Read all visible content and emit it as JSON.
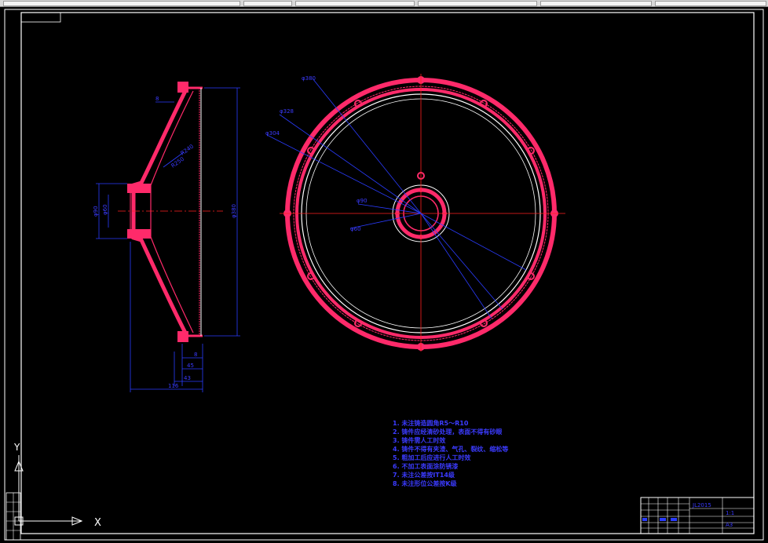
{
  "window": {
    "toolbar_segments": 6
  },
  "colors": {
    "background": "#000000",
    "frame": "#ffffff",
    "part": "#ff2a6a",
    "centerline": "#ff2020",
    "dimension": "#2a3cff",
    "titleblock": "#ffffff"
  },
  "side_view": {
    "dims": {
      "overall_height": "φ380",
      "hub_outer": "φ90",
      "hub_inner": "φ60",
      "inner_radius_1": "R240",
      "inner_radius_2": "R250",
      "small_dim": "8",
      "depth_1": "45",
      "depth_2": "43",
      "total_width": "116"
    }
  },
  "front_view": {
    "dims": {
      "d1": "φ380",
      "d2": "φ328",
      "d3": "φ304",
      "d4": "φ90",
      "d5": "φ60"
    }
  },
  "notes": {
    "lines": [
      "1. 未注铸造圆角R5～R10",
      "2. 铸件应经清砂处理，表面不得有砂眼",
      "3. 铸件需人工时效",
      "4. 铸件不得有夹渣、气孔、裂纹、缩松等",
      "5. 粗加工后应进行人工时效",
      "6. 不加工表面涂防锈漆",
      "7. 未注公差按IT14级",
      "8. 未注形位公差按K级"
    ]
  },
  "title_block": {
    "drawing_no": "JL2015",
    "scale": "1:1",
    "sheet": "A3"
  },
  "ucs": {
    "x_label": "X",
    "y_label": "Y"
  }
}
